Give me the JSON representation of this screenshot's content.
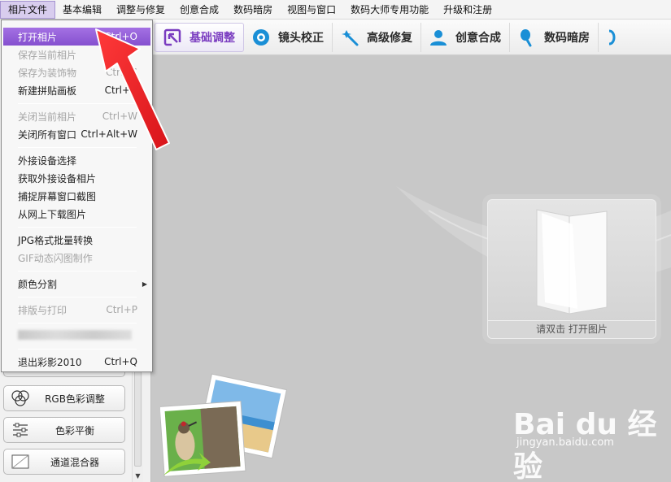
{
  "menubar": {
    "items": [
      "相片文件",
      "基本编辑",
      "调整与修复",
      "创意合成",
      "数码暗房",
      "视图与窗口",
      "数码大师专用功能",
      "升级和注册"
    ]
  },
  "toolbar": {
    "items": [
      {
        "label": "基础调整",
        "icon": "basic-adjust-icon"
      },
      {
        "label": "镜头校正",
        "icon": "lens-icon"
      },
      {
        "label": "高级修复",
        "icon": "magic-wand-icon"
      },
      {
        "label": "创意合成",
        "icon": "user-icon"
      },
      {
        "label": "数码暗房",
        "icon": "brush-icon"
      }
    ]
  },
  "dropdown": {
    "items": [
      {
        "label": "打开相片",
        "shortcut": "Ctrl+O",
        "state": "highlighted"
      },
      {
        "label": "保存当前相片",
        "shortcut": "",
        "state": "disabled"
      },
      {
        "label": "保存为装饰物",
        "shortcut": "Ctrl+S",
        "state": "disabled"
      },
      {
        "label": "新建拼贴画板",
        "shortcut": "Ctrl+N",
        "state": "normal"
      },
      {
        "label": "关闭当前相片",
        "shortcut": "Ctrl+W",
        "state": "disabled"
      },
      {
        "label": "关闭所有窗口",
        "shortcut": "Ctrl+Alt+W",
        "state": "normal"
      },
      {
        "label": "外接设备选择",
        "shortcut": "",
        "state": "normal"
      },
      {
        "label": "获取外接设备相片",
        "shortcut": "",
        "state": "normal"
      },
      {
        "label": "捕捉屏幕窗口截图",
        "shortcut": "",
        "state": "normal"
      },
      {
        "label": "从网上下载图片",
        "shortcut": "",
        "state": "normal"
      },
      {
        "label": "JPG格式批量转换",
        "shortcut": "",
        "state": "normal"
      },
      {
        "label": "GIF动态闪图制作",
        "shortcut": "",
        "state": "disabled"
      },
      {
        "label": "颜色分割",
        "shortcut": "",
        "state": "submenu"
      },
      {
        "label": "排版与打印",
        "shortcut": "Ctrl+P",
        "state": "disabled"
      },
      {
        "label": "退出彩影2010",
        "shortcut": "Ctrl+Q",
        "state": "normal"
      }
    ]
  },
  "leftpanel": {
    "buttons": [
      {
        "label": "RGB色彩调整",
        "icon": "rgb-circles-icon"
      },
      {
        "label": "色彩平衡",
        "icon": "sliders-icon"
      },
      {
        "label": "通道混合器",
        "icon": "channel-mixer-icon"
      }
    ]
  },
  "canvas": {
    "open_prompt": "请双击 打开图片"
  },
  "watermark": {
    "brand": "Bai du 经验",
    "url": "jingyan.baidu.com"
  },
  "colors": {
    "accent_purple": "#8550cf",
    "arrow_red": "#e8191f"
  }
}
